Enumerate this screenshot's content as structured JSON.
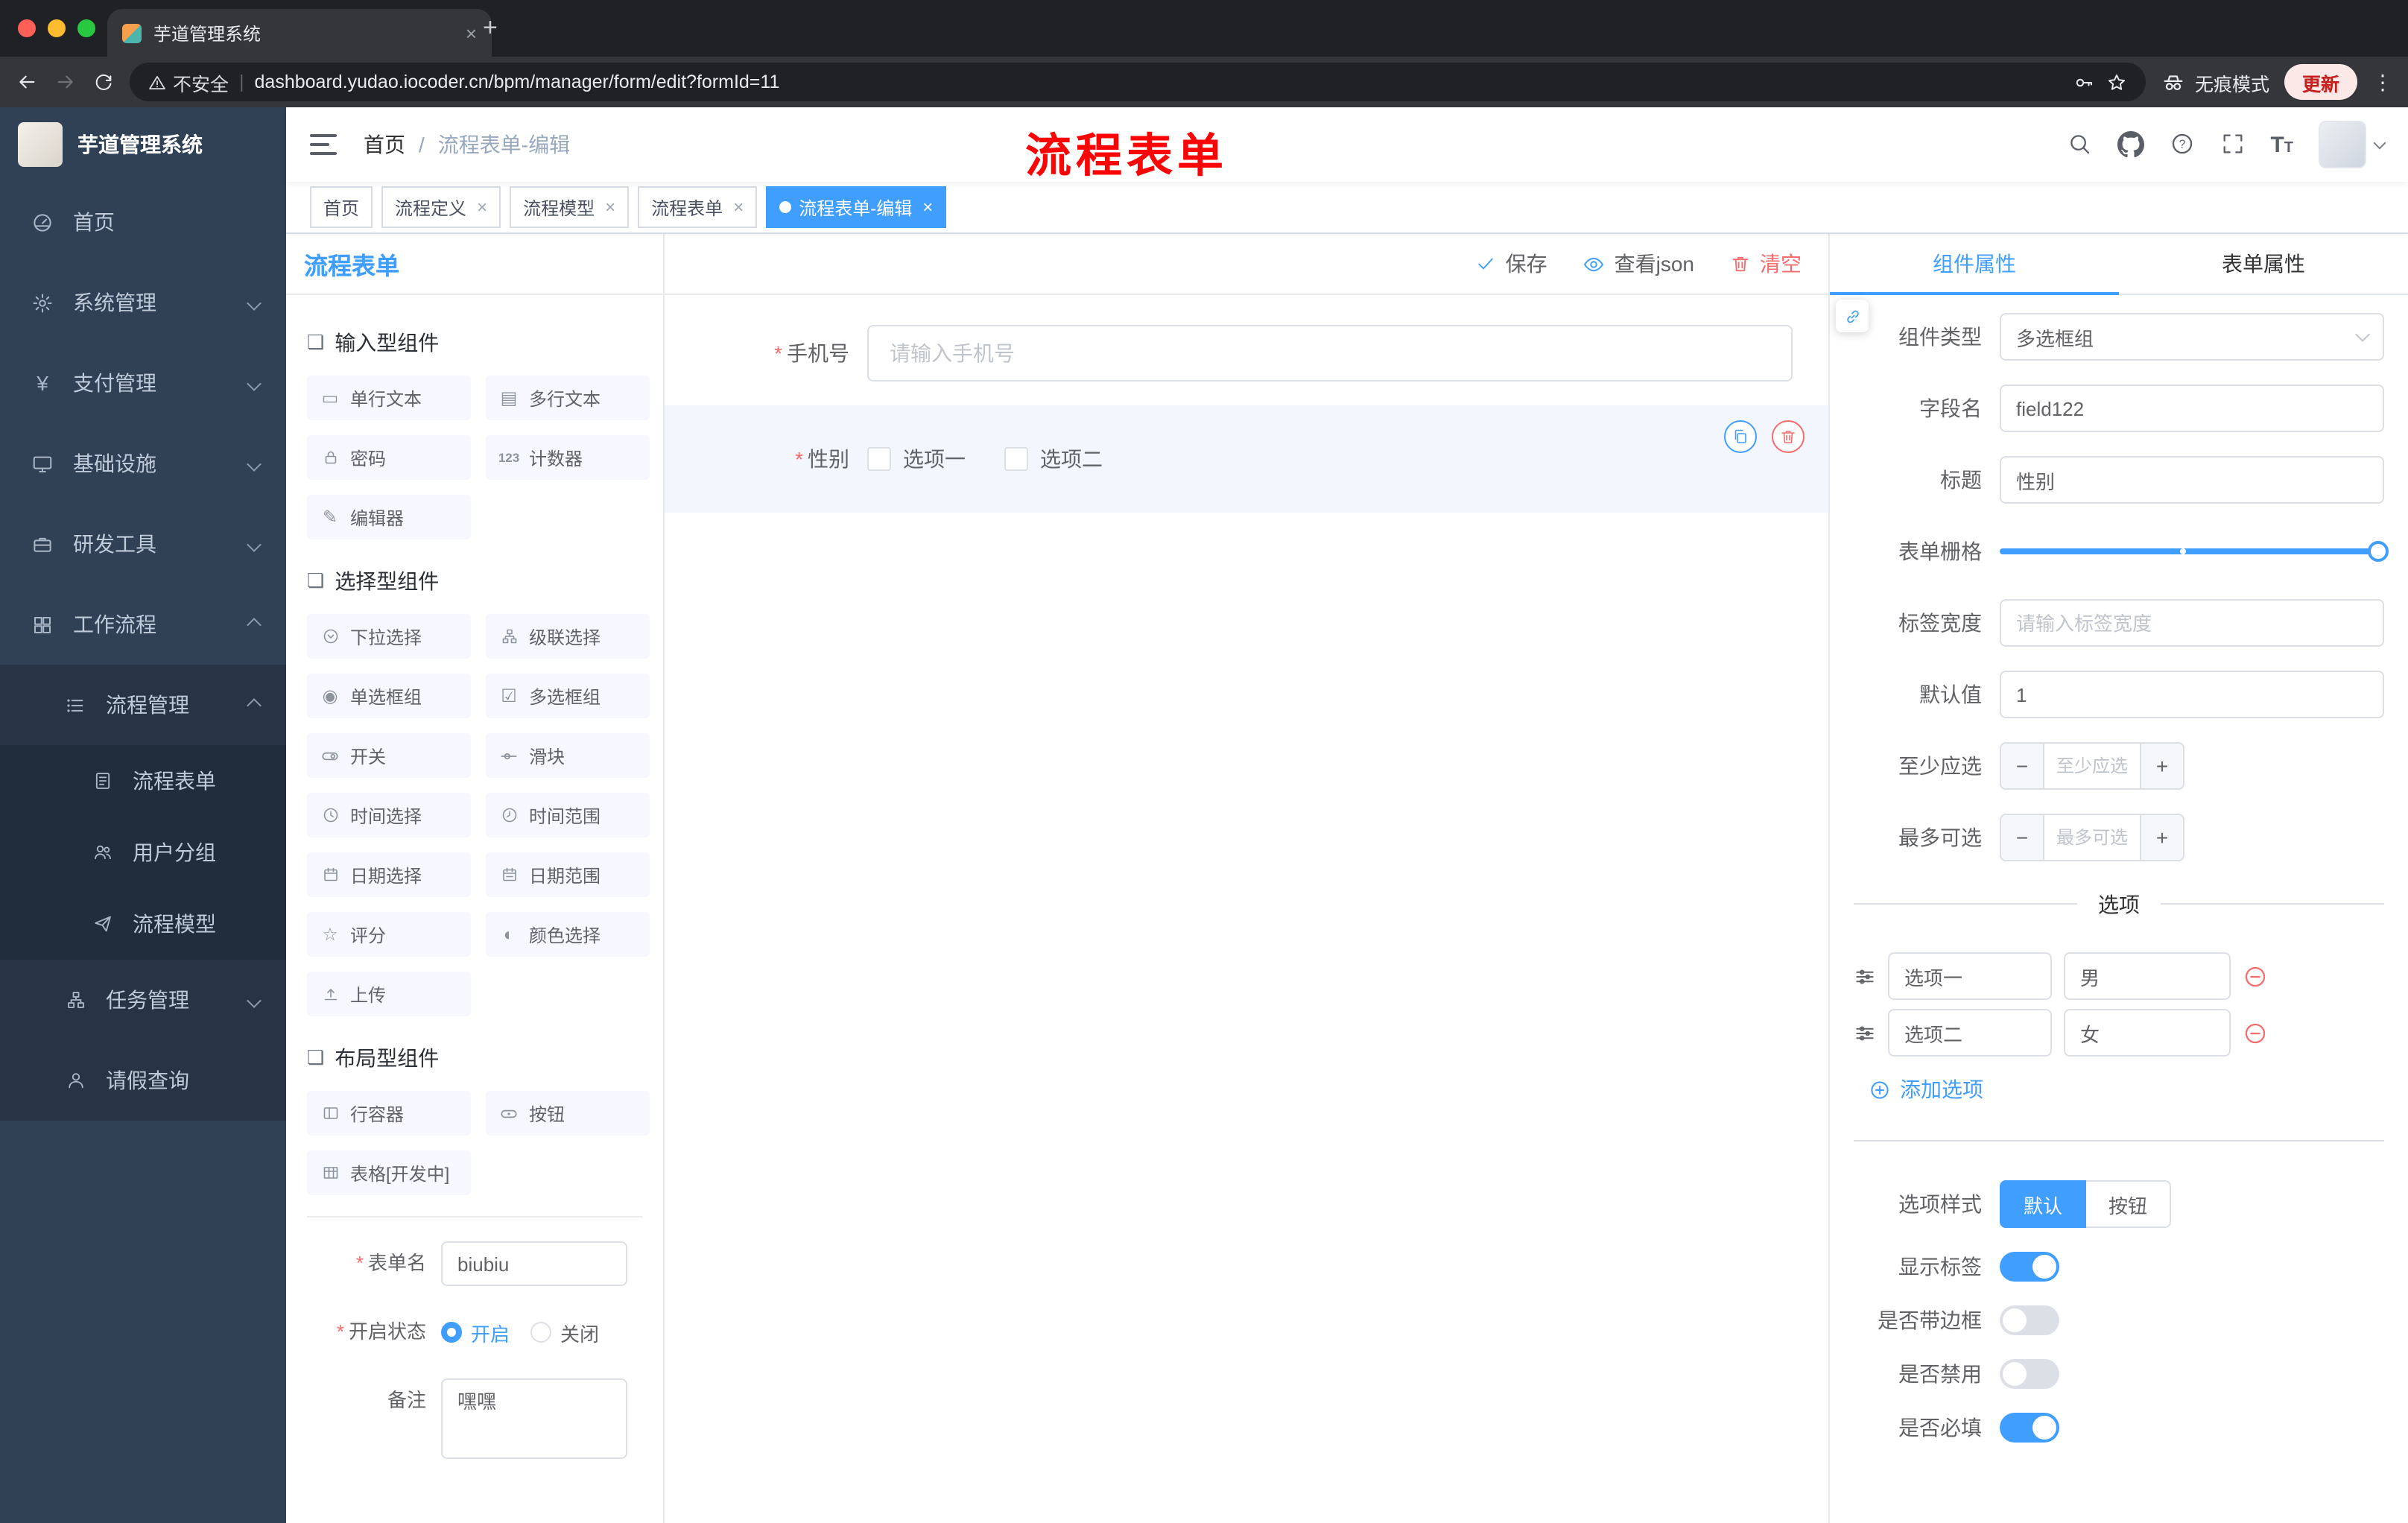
{
  "colors": {
    "accent": "#409EFF",
    "danger": "#F56C6C",
    "sidebar_bg": "#304156",
    "annotation": "#FB0405"
  },
  "browser": {
    "tab_title": "芋道管理系统",
    "security_label": "不安全",
    "url": "dashboard.yudao.iocoder.cn/bpm/manager/form/edit?formId=11",
    "incognito_label": "无痕模式",
    "update_label": "更新"
  },
  "sidebar": {
    "logo_title": "芋道管理系统",
    "items": [
      {
        "label": "首页",
        "icon": "dashboard-icon"
      },
      {
        "label": "系统管理",
        "icon": "gear-icon",
        "chevron": "down"
      },
      {
        "label": "支付管理",
        "icon": "payment-icon",
        "chevron": "down"
      },
      {
        "label": "基础设施",
        "icon": "infrastructure-icon",
        "chevron": "down"
      },
      {
        "label": "研发工具",
        "icon": "devtools-icon",
        "chevron": "down"
      },
      {
        "label": "工作流程",
        "icon": "workflow-icon",
        "chevron": "up"
      },
      {
        "label": "流程管理",
        "icon": "process-management-icon",
        "chevron": "up",
        "level": 2
      },
      {
        "label": "流程表单",
        "icon": "process-form-icon",
        "level": 3
      },
      {
        "label": "用户分组",
        "icon": "user-group-icon",
        "level": 3
      },
      {
        "label": "流程模型",
        "icon": "process-model-icon",
        "level": 3
      },
      {
        "label": "任务管理",
        "icon": "task-management-icon",
        "chevron": "down",
        "level": 2
      },
      {
        "label": "请假查询",
        "icon": "leave-query-icon",
        "level": 2
      }
    ]
  },
  "header": {
    "breadcrumb_first": "首页",
    "breadcrumb_sep": "/",
    "breadcrumb_last": "流程表单-编辑",
    "annotation": "流程表单"
  },
  "tags": [
    {
      "label": "首页",
      "closable": false,
      "active": false
    },
    {
      "label": "流程定义",
      "closable": true,
      "active": false
    },
    {
      "label": "流程模型",
      "closable": true,
      "active": false
    },
    {
      "label": "流程表单",
      "closable": true,
      "active": false
    },
    {
      "label": "流程表单-编辑",
      "closable": true,
      "active": true
    }
  ],
  "designer": {
    "title": "流程表单",
    "actions": {
      "save": "保存",
      "view_json": "查看json",
      "clear": "清空"
    },
    "palette": {
      "sections": [
        {
          "title": "输入型组件",
          "items": [
            {
              "label": "单行文本",
              "icon": "text-input-icon"
            },
            {
              "label": "多行文本",
              "icon": "textarea-icon"
            },
            {
              "label": "密码",
              "icon": "password-icon"
            },
            {
              "label": "计数器",
              "icon": "counter-icon"
            },
            {
              "label": "编辑器",
              "icon": "editor-icon"
            }
          ]
        },
        {
          "title": "选择型组件",
          "items": [
            {
              "label": "下拉选择",
              "icon": "select-icon"
            },
            {
              "label": "级联选择",
              "icon": "cascader-icon"
            },
            {
              "label": "单选框组",
              "icon": "radio-group-icon"
            },
            {
              "label": "多选框组",
              "icon": "checkbox-group-icon"
            },
            {
              "label": "开关",
              "icon": "switch-icon"
            },
            {
              "label": "滑块",
              "icon": "slider-icon"
            },
            {
              "label": "时间选择",
              "icon": "time-picker-icon"
            },
            {
              "label": "时间范围",
              "icon": "time-range-icon"
            },
            {
              "label": "日期选择",
              "icon": "date-picker-icon"
            },
            {
              "label": "日期范围",
              "icon": "date-range-icon"
            },
            {
              "label": "评分",
              "icon": "rate-icon"
            },
            {
              "label": "颜色选择",
              "icon": "color-picker-icon"
            },
            {
              "label": "上传",
              "icon": "upload-icon"
            }
          ]
        },
        {
          "title": "布局型组件",
          "items": [
            {
              "label": "行容器",
              "icon": "row-container-icon"
            },
            {
              "label": "按钮",
              "icon": "button-icon"
            },
            {
              "label": "表格[开发中]",
              "icon": "table-icon"
            }
          ]
        }
      ]
    },
    "form_meta": {
      "name_label": "表单名",
      "name_value": "biubiu",
      "status_label": "开启状态",
      "status_on": "开启",
      "status_off": "关闭",
      "remark_label": "备注",
      "remark_value": "嘿嘿"
    },
    "canvas": {
      "phone": {
        "label": "手机号",
        "placeholder": "请输入手机号"
      },
      "gender": {
        "label": "性别",
        "options": [
          "选项一",
          "选项二"
        ]
      }
    },
    "properties": {
      "tabs": [
        {
          "label": "组件属性",
          "active": true
        },
        {
          "label": "表单属性",
          "active": false
        }
      ],
      "fields": {
        "component_type_label": "组件类型",
        "component_type_value": "多选框组",
        "field_name_label": "字段名",
        "field_name_value": "field122",
        "title_label": "标题",
        "title_value": "性别",
        "grid_label": "表单栅格",
        "label_width_label": "标签宽度",
        "label_width_placeholder": "请输入标签宽度",
        "default_label": "默认值",
        "default_value": "1",
        "min_label": "至少应选",
        "min_placeholder": "至少应选",
        "max_label": "最多可选",
        "max_placeholder": "最多可选"
      },
      "options_divider": "选项",
      "options": [
        {
          "label": "选项一",
          "value": "男"
        },
        {
          "label": "选项二",
          "value": "女"
        }
      ],
      "add_option": "添加选项",
      "style_label": "选项样式",
      "style_default": "默认",
      "style_button": "按钮",
      "toggles": [
        {
          "label": "显示标签",
          "on": true
        },
        {
          "label": "是否带边框",
          "on": false
        },
        {
          "label": "是否禁用",
          "on": false
        },
        {
          "label": "是否必填",
          "on": true
        }
      ]
    }
  }
}
